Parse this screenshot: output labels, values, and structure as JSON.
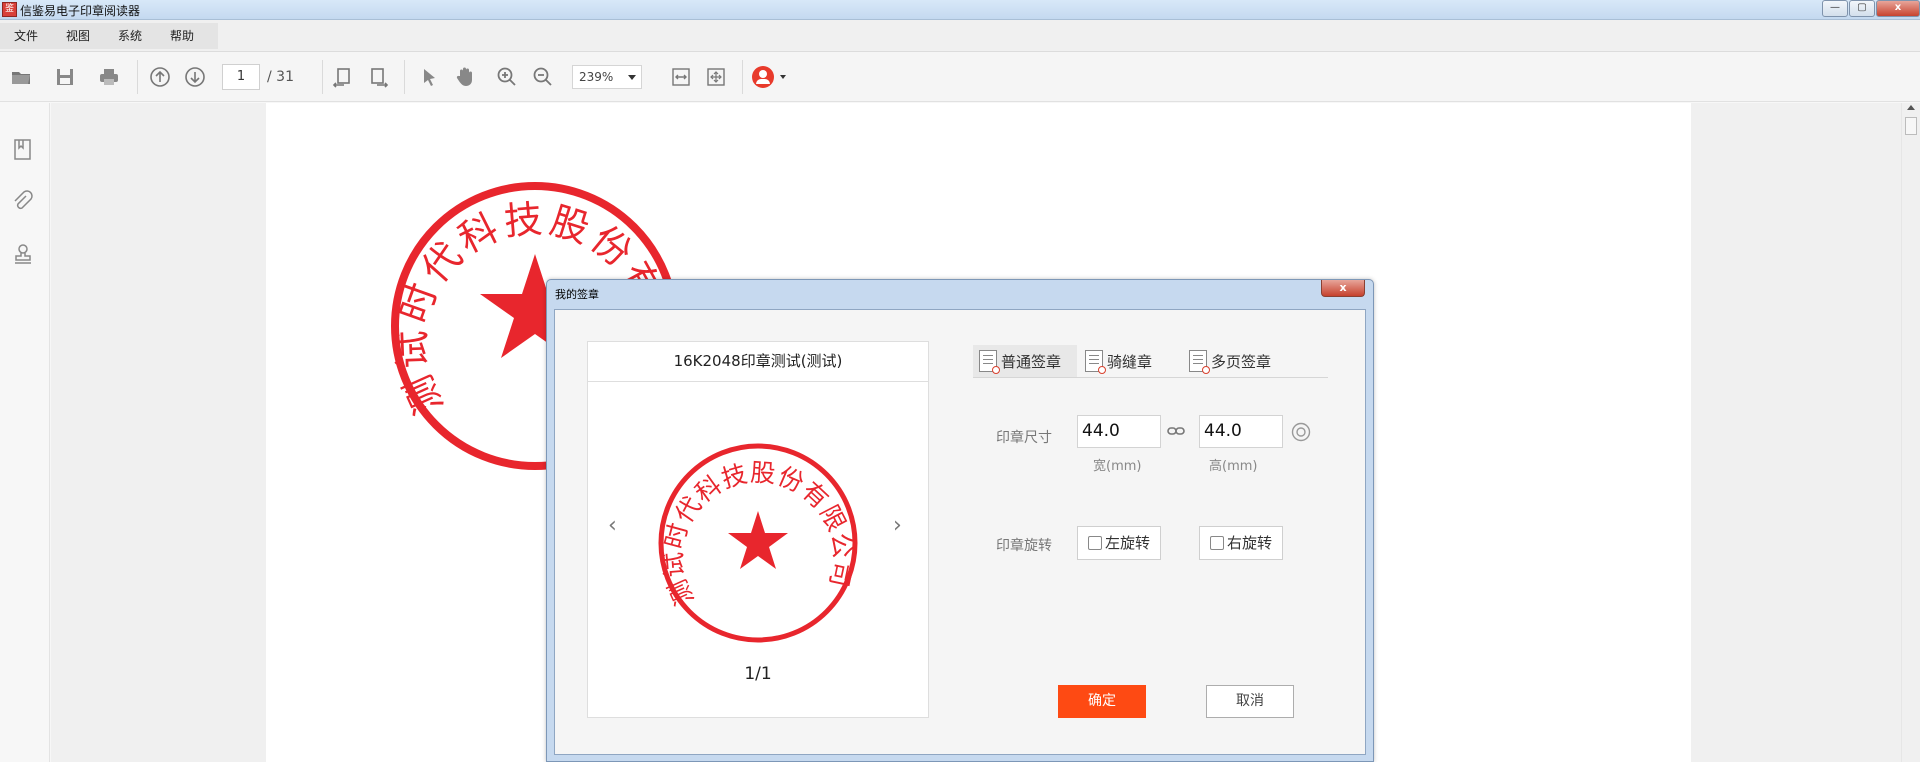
{
  "app": {
    "title": "信鉴易电子印章阅读器",
    "icon_text": "鉴"
  },
  "window_buttons": {
    "minimize": "—",
    "maximize": "▢",
    "close": "x"
  },
  "menu": [
    {
      "label": "文件"
    },
    {
      "label": "视图"
    },
    {
      "label": "系统"
    },
    {
      "label": "帮助"
    }
  ],
  "toolbar": {
    "current_page": "1",
    "total_pages": "/ 31",
    "zoom": "239%"
  },
  "left_panel": {
    "icons": [
      "bookmark-icon",
      "attachment-icon",
      "stamp-icon"
    ]
  },
  "dialog": {
    "title": "我的签章",
    "close_label": "x",
    "seal_card": {
      "title": "16K2048印章测试(测试)",
      "page_indicator": "1/1",
      "prev_arrow": "‹",
      "next_arrow": "›"
    },
    "tabs": [
      {
        "label": "普通签章",
        "active": true
      },
      {
        "label": "骑缝章",
        "active": false
      },
      {
        "label": "多页签章",
        "active": false
      }
    ],
    "size": {
      "label": "印章尺寸",
      "width_value": "44.0",
      "height_value": "44.0",
      "width_unit": "宽(mm)",
      "height_unit": "高(mm)"
    },
    "rotation": {
      "label": "印章旋转",
      "left_button": "左旋转",
      "right_button": "右旋转"
    },
    "confirm_button": "确定",
    "cancel_button": "取消"
  },
  "seal": {
    "text": "测试时代科技股份有限公司",
    "color": "#e8262d"
  },
  "colors": {
    "accent": "#fe4a13",
    "seal_red": "#e8262d",
    "titlebar": "#c4d9f0"
  }
}
